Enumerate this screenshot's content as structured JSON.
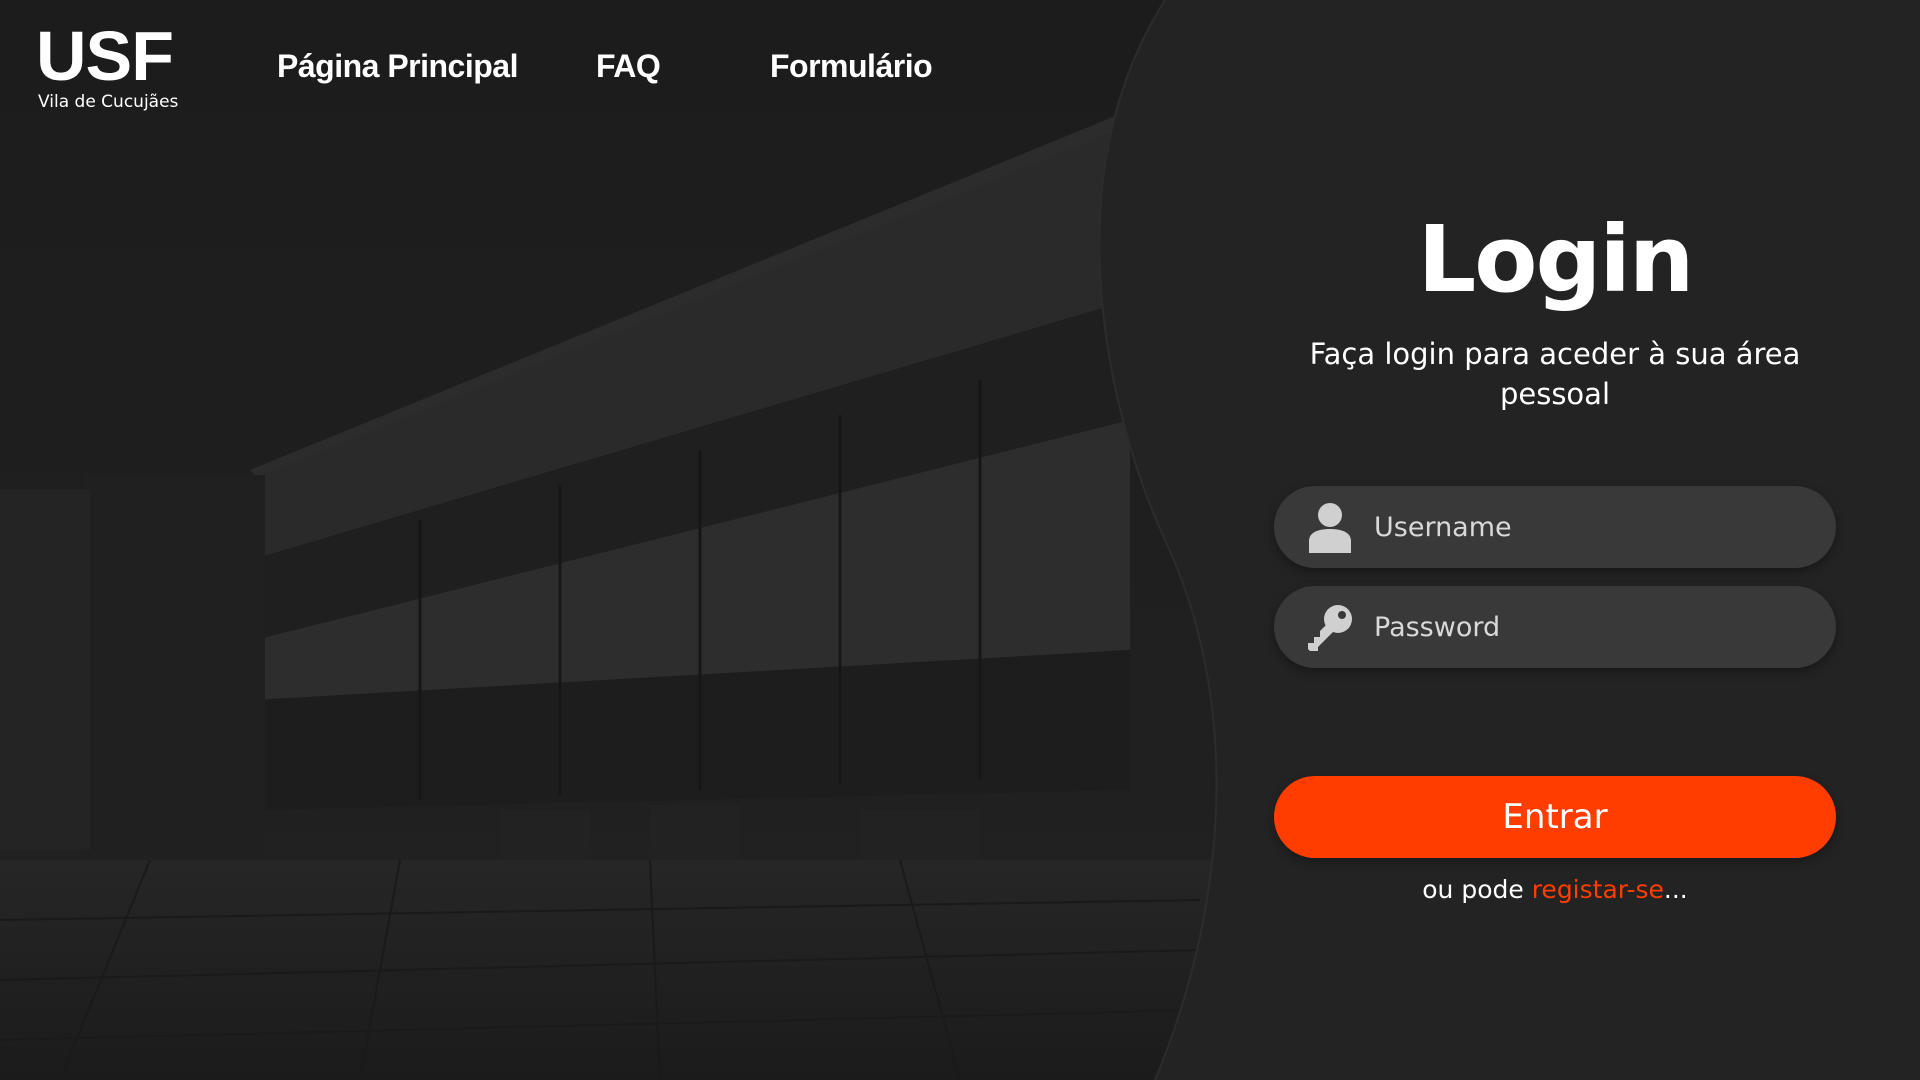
{
  "brand": {
    "logo_text": "USF",
    "logo_subtitle": "Vila de Cucujães"
  },
  "nav": {
    "items": [
      {
        "label": "Página Principal"
      },
      {
        "label": "FAQ"
      },
      {
        "label": "Formulário"
      }
    ]
  },
  "login": {
    "title": "Login",
    "subtitle": "Faça login para aceder à sua área pessoal",
    "username": {
      "placeholder": "Username",
      "value": "",
      "icon": "user-icon"
    },
    "password": {
      "placeholder": "Password",
      "value": "",
      "icon": "key-icon"
    },
    "submit_label": "Entrar",
    "register_prefix": "ou pode ",
    "register_link": "registar-se",
    "register_suffix": "..."
  },
  "colors": {
    "accent": "#ff3d00",
    "panel": "#232323",
    "field": "#393939",
    "background": "#161616"
  }
}
